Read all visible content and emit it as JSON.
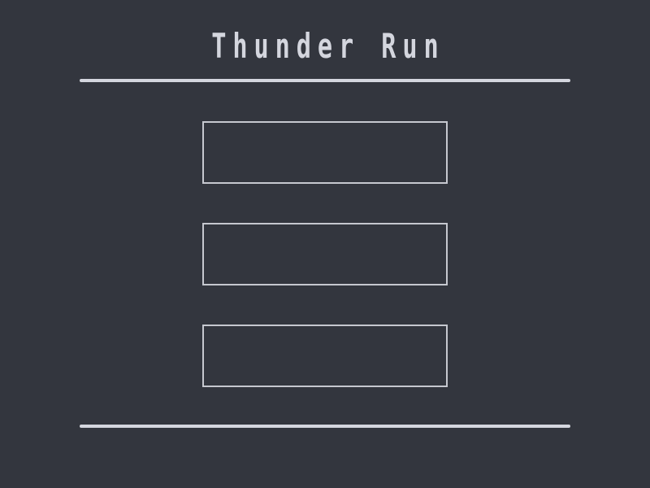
{
  "title": "Thunder Run",
  "menu": {
    "buttons": [
      {
        "label": ""
      },
      {
        "label": ""
      },
      {
        "label": ""
      }
    ]
  },
  "colors": {
    "background": "#33363e",
    "foreground": "#d4d6de",
    "button_border": "#c6c8cf"
  }
}
